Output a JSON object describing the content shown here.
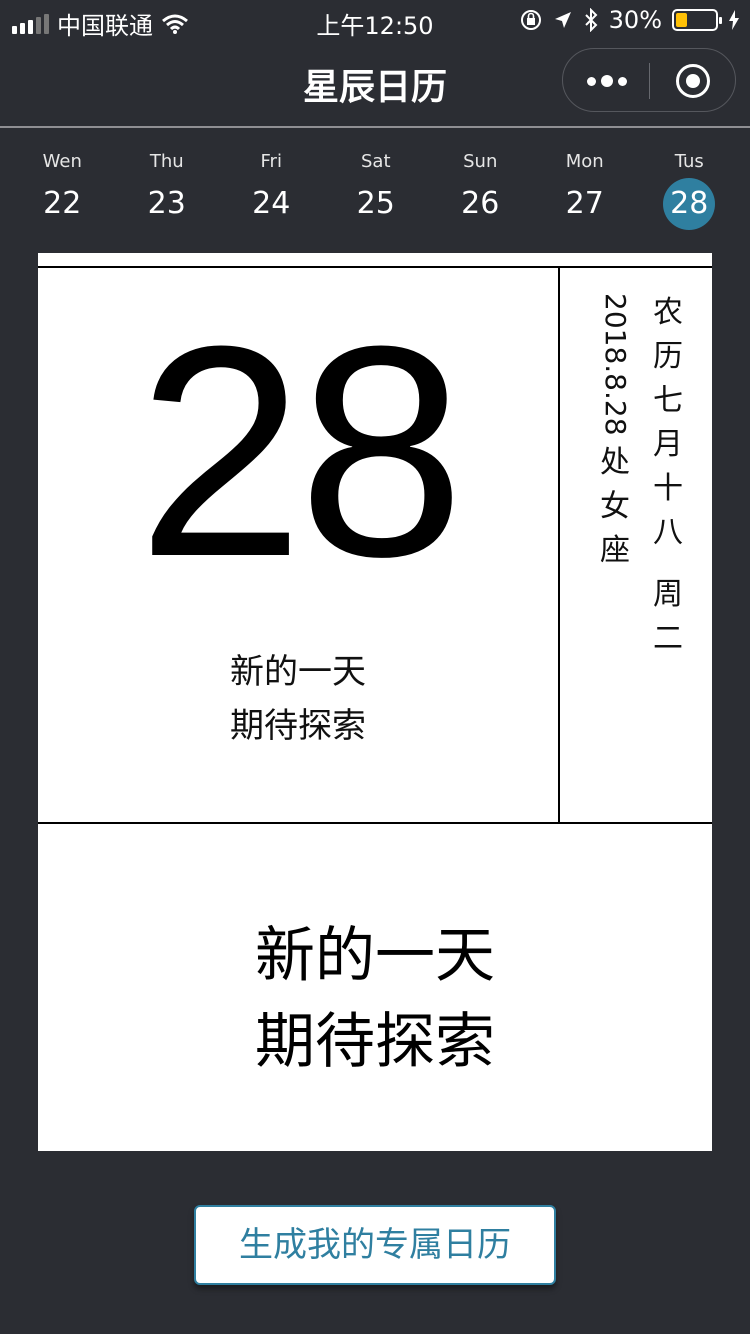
{
  "status_bar": {
    "carrier": "中国联通",
    "time": "上午12:50",
    "battery": "30%",
    "battery_level": 0.3
  },
  "nav": {
    "title": "星辰日历"
  },
  "week": [
    {
      "dow": "Wen",
      "num": "22"
    },
    {
      "dow": "Thu",
      "num": "23"
    },
    {
      "dow": "Fri",
      "num": "24"
    },
    {
      "dow": "Sat",
      "num": "25"
    },
    {
      "dow": "Sun",
      "num": "26"
    },
    {
      "dow": "Mon",
      "num": "27"
    },
    {
      "dow": "Tus",
      "num": "28",
      "active": true
    }
  ],
  "card": {
    "day": "28",
    "quote_line1": "新的一天",
    "quote_line2": "期待探索",
    "lunar": [
      "农",
      "历",
      "七",
      "月",
      "十",
      "八",
      "周",
      "二"
    ],
    "solar_date": "2018.8.28",
    "zodiac": [
      "处",
      "女",
      "座"
    ]
  },
  "action": {
    "generate_label": "生成我的专属日历"
  },
  "colors": {
    "background": "#2b2d33",
    "accent": "#2f7fa0",
    "battery": "#ffc107"
  }
}
